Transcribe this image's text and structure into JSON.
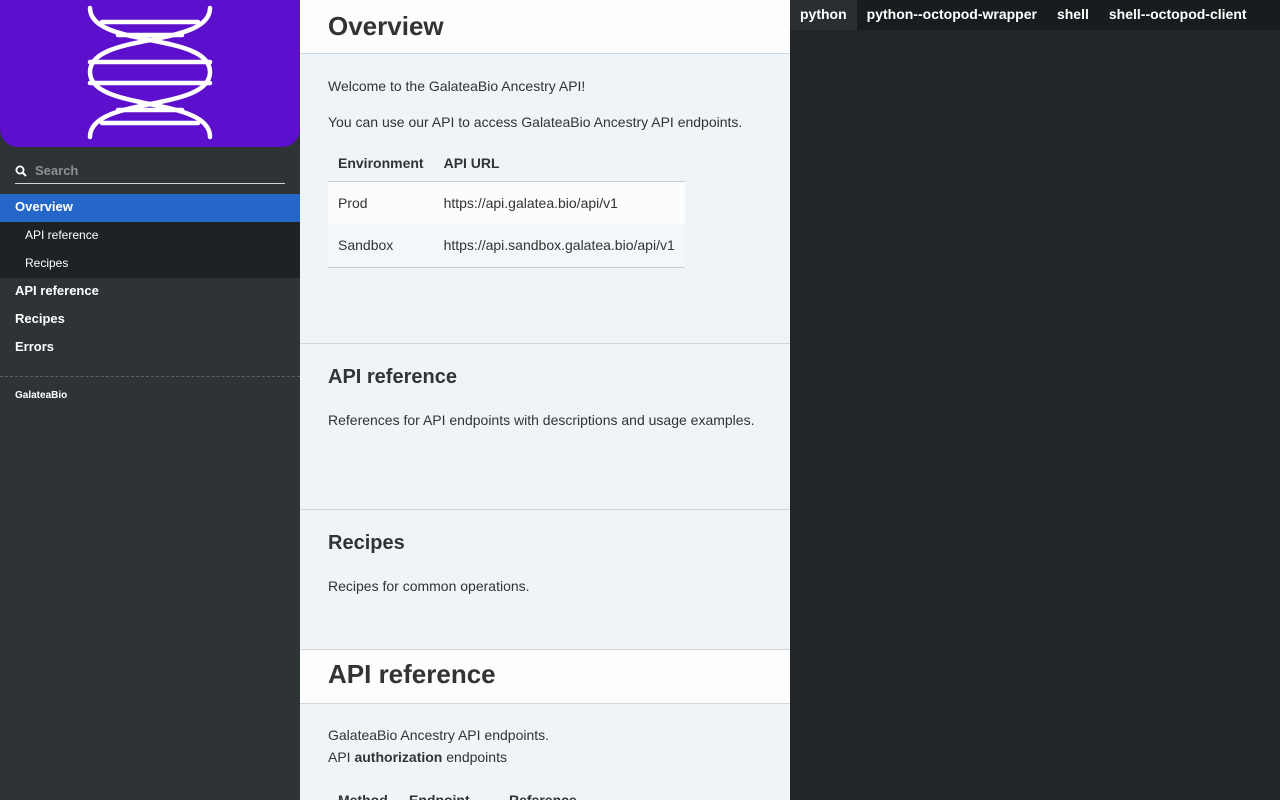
{
  "sidebar": {
    "logo": "dna-helix-logo",
    "search_placeholder": "Search",
    "toc": {
      "overview": "Overview",
      "overview_sub": [
        "API reference",
        "Recipes"
      ],
      "items": [
        "API reference",
        "Recipes",
        "Errors"
      ]
    },
    "footer": "GalateaBio"
  },
  "overview": {
    "title": "Overview",
    "welcome": "Welcome to the GalateaBio Ancestry API!",
    "intro": "You can use our API to access GalateaBio Ancestry API endpoints.",
    "env_table": {
      "headers": [
        "Environment",
        "API URL"
      ],
      "rows": [
        [
          "Prod",
          "https://api.galatea.bio/api/v1"
        ],
        [
          "Sandbox",
          "https://api.sandbox.galatea.bio/api/v1"
        ]
      ]
    }
  },
  "api_ref_section": {
    "title": "API reference",
    "text": "References for API endpoints with descriptions and usage examples."
  },
  "recipes_section": {
    "title": "Recipes",
    "text": "Recipes for common operations."
  },
  "api_reference": {
    "title": "API reference",
    "line1": "GalateaBio Ancestry API endpoints.",
    "line2_prefix": "API",
    "line2_bold": "authorization",
    "line2_suffix": "endpoints",
    "table_headers": [
      "Method",
      "Endpoint",
      "Reference"
    ]
  },
  "code_pane": {
    "tabs": [
      "python",
      "python--octopod-wrapper",
      "shell",
      "shell--octopod-client"
    ],
    "active_tab": "python"
  },
  "colors": {
    "logo_bg": "#5c0fcc",
    "active_toc": "#2467c8",
    "sidebar_bg": "#2e3336",
    "code_bg": "#212528"
  }
}
